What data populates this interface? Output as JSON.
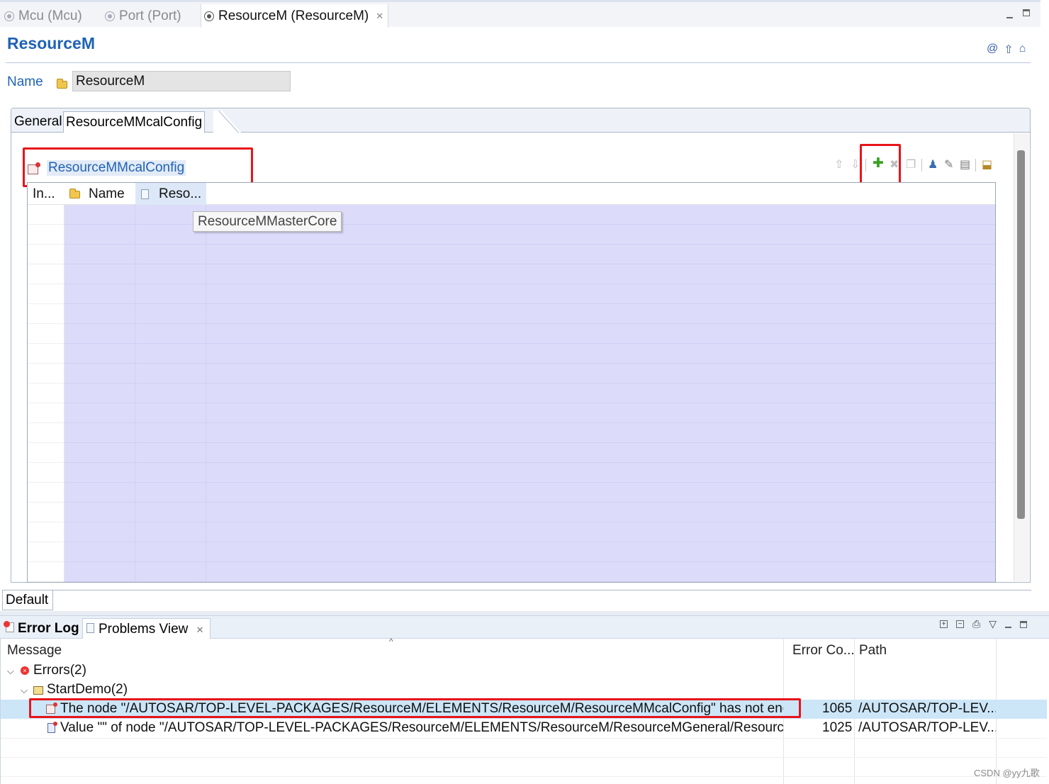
{
  "editor_tabs": [
    {
      "label": "Mcu (Mcu)"
    },
    {
      "label": "Port (Port)"
    },
    {
      "label": "ResourceM (ResourceM)",
      "active": true
    }
  ],
  "editor": {
    "title": "ResourceM",
    "name_label": "Name",
    "name_value": "ResourceM",
    "tabs": [
      "General",
      "ResourceMMcalConfig"
    ],
    "section_title": "ResourceMMcalConfig",
    "table": {
      "columns": [
        "In...",
        "Name",
        "Reso..."
      ],
      "tooltip": "ResourceMMasterCore"
    },
    "bottom_tab": "Default"
  },
  "views": {
    "tabs": [
      "Error Log",
      "Problems View"
    ],
    "problems": {
      "columns": [
        "Message",
        "Error Co...",
        "Path"
      ],
      "rows": [
        {
          "level": 0,
          "text": "Errors(2)",
          "code": "",
          "path": ""
        },
        {
          "level": 1,
          "text": "StartDemo(2)",
          "code": "",
          "path": ""
        },
        {
          "level": 2,
          "text": "The node \"/AUTOSAR/TOP-LEVEL-PACKAGES/ResourceM/ELEMENTS/ResourceM/ResourceMMcalConfig\" has not enou",
          "code": "1065",
          "path": "/AUTOSAR/TOP-LEV...",
          "selected": true
        },
        {
          "level": 2,
          "text": "Value \"\" of node \"/AUTOSAR/TOP-LEVEL-PACKAGES/ResourceM/ELEMENTS/ResourceM/ResourceMGeneral/ResourceM",
          "code": "1025",
          "path": "/AUTOSAR/TOP-LEV..."
        }
      ]
    }
  },
  "watermark": "CSDN @yy九歌",
  "colors": {
    "accent": "#1f63b5",
    "highlight_box": "#e8141a",
    "grid_fill": "#dcdcfa",
    "selected_row": "#cce6f8"
  },
  "icons": [
    "editor-tab-icon",
    "close-icon",
    "folder-icon",
    "config-node-icon",
    "move-up-icon",
    "move-down-icon",
    "add-icon",
    "delete-icon",
    "copy-icon",
    "user-icon",
    "edit-icon",
    "table-edit-icon",
    "export-icon",
    "error-log-icon",
    "problems-icon",
    "expand-all-icon",
    "collapse-all-icon",
    "error-icon",
    "package-icon",
    "value-error-icon"
  ]
}
